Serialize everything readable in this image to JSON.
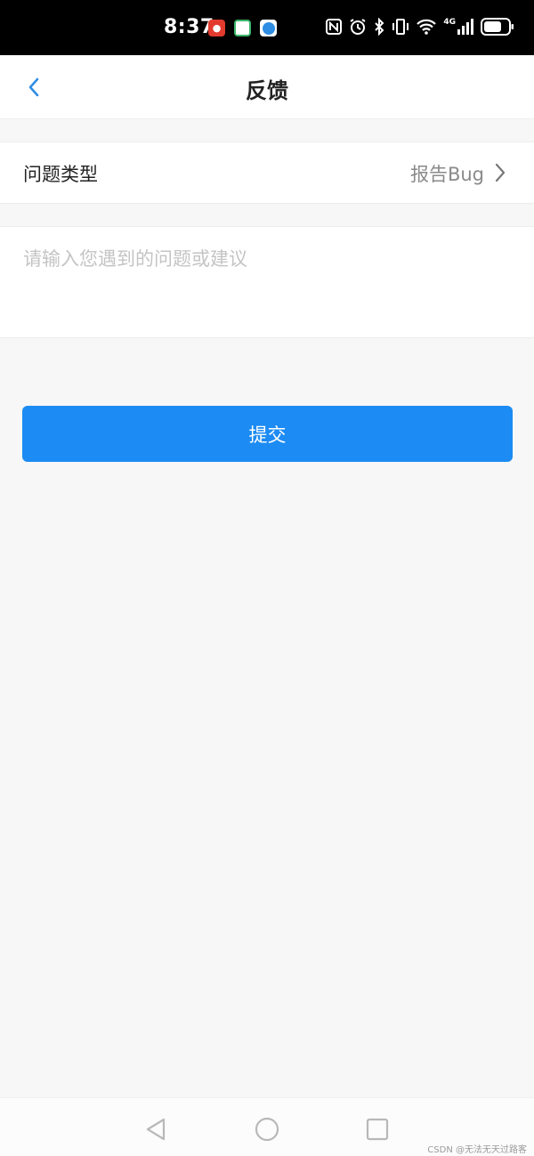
{
  "status_bar": {
    "time": "8:37",
    "network": "4G"
  },
  "header": {
    "title": "反馈"
  },
  "issue_type": {
    "label": "问题类型",
    "value": "报告Bug"
  },
  "feedback": {
    "placeholder": "请输入您遇到的问题或建议",
    "value": ""
  },
  "submit": {
    "label": "提交"
  },
  "watermark": "CSDN @无法无天过路客",
  "colors": {
    "accent": "#1c8bf3",
    "back_arrow": "#2f8de4",
    "background": "#f7f7f7"
  },
  "icons": [
    "back-arrow-icon",
    "chevron-right-icon",
    "nfc-icon",
    "alarm-icon",
    "bluetooth-icon",
    "vibrate-icon",
    "wifi-icon",
    "signal-icon",
    "battery-icon"
  ]
}
